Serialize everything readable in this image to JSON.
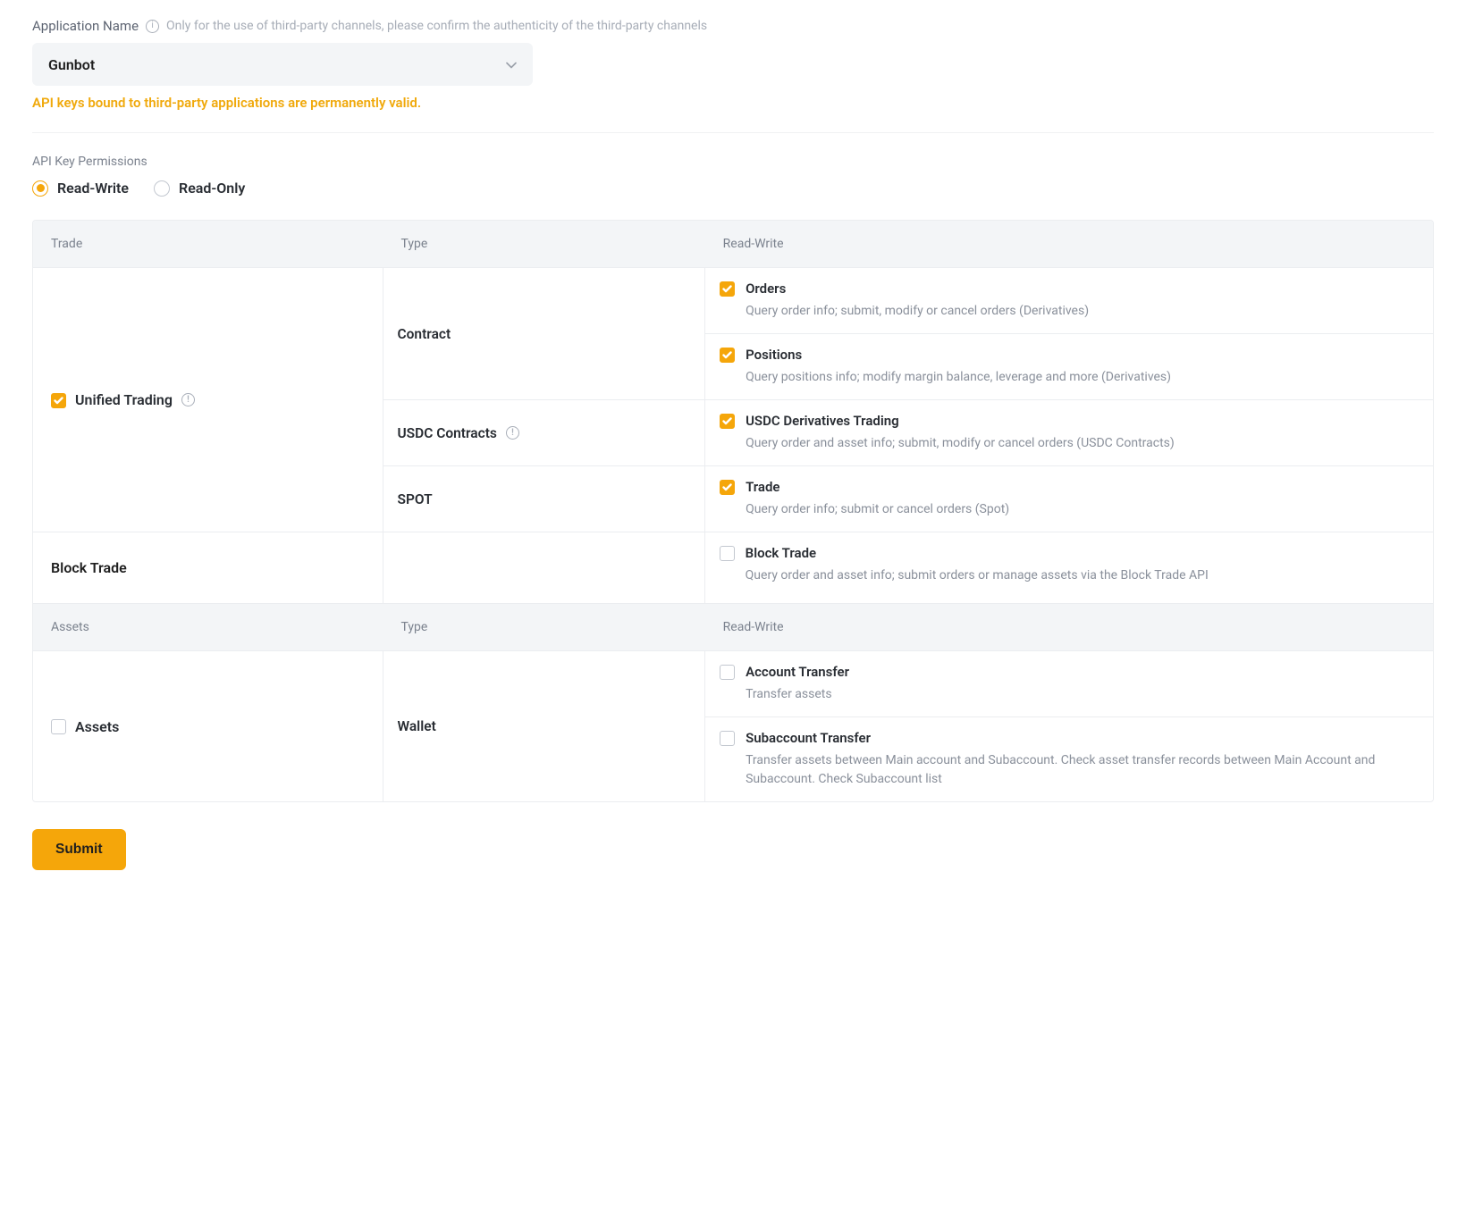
{
  "app_name": {
    "label": "Application Name",
    "hint": "Only for the use of third-party channels, please confirm the authenticity of the third-party channels",
    "value": "Gunbot"
  },
  "notice": "API keys bound to third-party applications are permanently valid.",
  "permissions_label": "API Key Permissions",
  "radios": {
    "rw": "Read-Write",
    "ro": "Read-Only",
    "selected": "rw"
  },
  "table": {
    "headers": {
      "col1": "Trade",
      "col2": "Type",
      "col3": "Read-Write"
    },
    "assets_header": {
      "col1": "Assets",
      "col2": "Type",
      "col3": "Read-Write"
    },
    "rows": {
      "unified_trading": {
        "label": "Unified Trading",
        "checked": true,
        "types": [
          {
            "label": "Contract",
            "info": false,
            "perms": [
              {
                "label": "Orders",
                "checked": true,
                "desc": "Query order info; submit, modify or cancel orders (Derivatives)"
              },
              {
                "label": "Positions",
                "checked": true,
                "desc": "Query positions info; modify margin balance, leverage and more (Derivatives)"
              }
            ]
          },
          {
            "label": "USDC Contracts",
            "info": true,
            "perms": [
              {
                "label": "USDC Derivatives Trading",
                "checked": true,
                "desc": "Query order and asset info; submit, modify or cancel orders (USDC Contracts)"
              }
            ]
          },
          {
            "label": "SPOT",
            "info": false,
            "perms": [
              {
                "label": "Trade",
                "checked": true,
                "desc": "Query order info; submit or cancel orders (Spot)"
              }
            ]
          }
        ]
      },
      "block_trade": {
        "label": "Block Trade",
        "perm": {
          "label": "Block Trade",
          "checked": false,
          "desc": "Query order and asset info; submit orders or manage assets via the Block Trade API"
        }
      },
      "assets": {
        "label": "Assets",
        "checked": false,
        "types": [
          {
            "label": "Wallet",
            "info": false,
            "perms": [
              {
                "label": "Account Transfer",
                "checked": false,
                "desc": "Transfer assets"
              },
              {
                "label": "Subaccount Transfer",
                "checked": false,
                "desc": "Transfer assets between Main account and Subaccount. Check asset transfer records between Main Account and Subaccount. Check Subaccount list"
              }
            ]
          }
        ]
      }
    }
  },
  "submit_label": "Submit"
}
